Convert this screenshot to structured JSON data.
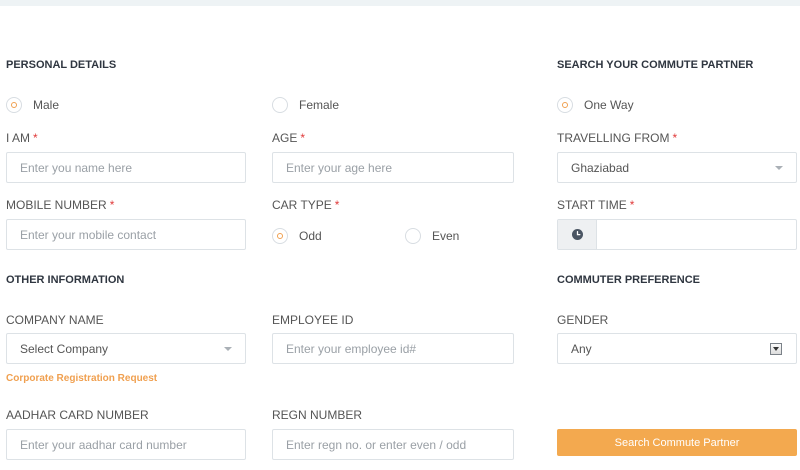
{
  "personal": {
    "title": "PERSONAL DETAILS",
    "gender_male": "Male",
    "gender_female": "Female",
    "i_am_label": "I AM",
    "i_am_placeholder": "Enter you name here",
    "age_label": "AGE",
    "age_placeholder": "Enter your age here",
    "mobile_label": "MOBILE NUMBER",
    "mobile_placeholder": "Enter your mobile contact",
    "car_type_label": "CAR TYPE",
    "car_odd": "Odd",
    "car_even": "Even",
    "required_mark": "*"
  },
  "other": {
    "title": "OTHER INFORMATION",
    "company_label": "COMPANY NAME",
    "company_value": "Select Company",
    "corporate_link": "Corporate Registration Request",
    "employee_label": "EMPLOYEE ID",
    "employee_placeholder": "Enter your employee id#",
    "aadhar_label": "AADHAR CARD NUMBER",
    "aadhar_placeholder": "Enter your aadhar card number",
    "regn_label": "REGN NUMBER",
    "regn_placeholder": "Enter regn no. or enter even / odd"
  },
  "search": {
    "title": "SEARCH YOUR COMMUTE PARTNER",
    "one_way": "One Way",
    "travelling_from_label": "TRAVELLING FROM",
    "travelling_from_value": "Ghaziabad",
    "start_time_label": "START TIME",
    "start_time_value": ""
  },
  "preference": {
    "title": "COMMUTER PREFERENCE",
    "gender_label": "GENDER",
    "gender_value": "Any",
    "search_button": "Search Commute Partner"
  },
  "icons": {
    "clock": "clock-icon",
    "dropdown": "chevron-down-icon"
  },
  "colors": {
    "accent": "#f3a94f",
    "required": "#e03a3a",
    "heading": "#2f3640"
  }
}
